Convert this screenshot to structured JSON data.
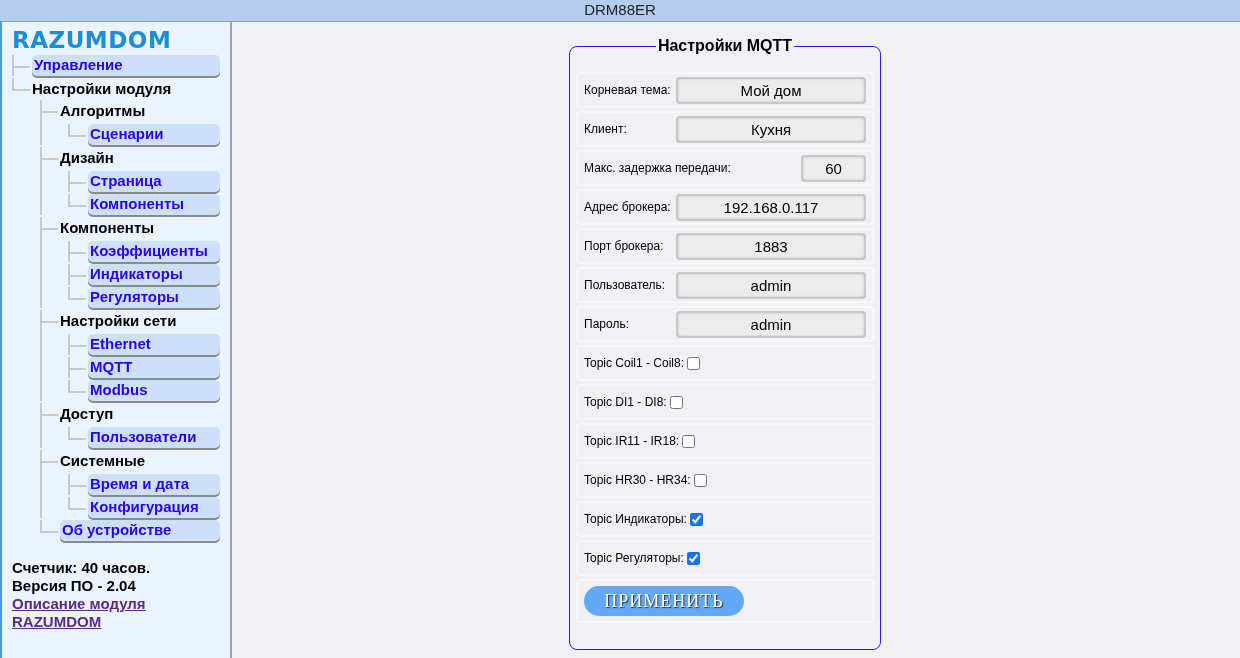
{
  "window": {
    "title": "DRM88ER"
  },
  "sidebar": {
    "logo": "RAZUMDOM",
    "tree": [
      {
        "kind": "link",
        "label": "Управление"
      },
      {
        "kind": "group",
        "label": "Настройки модуля",
        "children": [
          {
            "kind": "group",
            "label": "Алгоритмы",
            "children": [
              {
                "kind": "link",
                "label": "Сценарии"
              }
            ]
          },
          {
            "kind": "group",
            "label": "Дизайн",
            "children": [
              {
                "kind": "link",
                "label": "Страница"
              },
              {
                "kind": "link",
                "label": "Компоненты"
              }
            ]
          },
          {
            "kind": "group",
            "label": "Компоненты",
            "children": [
              {
                "kind": "link",
                "label": "Коэффициенты"
              },
              {
                "kind": "link",
                "label": "Индикаторы"
              },
              {
                "kind": "link",
                "label": "Регуляторы"
              }
            ]
          },
          {
            "kind": "group",
            "label": "Настройки сети",
            "children": [
              {
                "kind": "link",
                "label": "Ethernet"
              },
              {
                "kind": "link",
                "label": "MQTT"
              },
              {
                "kind": "link",
                "label": "Modbus"
              }
            ]
          },
          {
            "kind": "group",
            "label": "Доступ",
            "children": [
              {
                "kind": "link",
                "label": "Пользователи"
              }
            ]
          },
          {
            "kind": "group",
            "label": "Системные",
            "children": [
              {
                "kind": "link",
                "label": "Время и дата"
              },
              {
                "kind": "link",
                "label": "Конфигурация"
              }
            ]
          },
          {
            "kind": "link",
            "label": "Об устройстве"
          }
        ]
      }
    ],
    "info": [
      "Счетчик: 40 часов.",
      "Версия ПО - 2.04"
    ],
    "link_lines": [
      "Описание модуля",
      "RAZUMDOM"
    ]
  },
  "panel": {
    "title": "Настройки MQTT",
    "rows": [
      {
        "kind": "text",
        "label": "Корневая тема:",
        "value": "Мой дом"
      },
      {
        "kind": "text",
        "label": "Клиент:",
        "value": "Кухня"
      },
      {
        "kind": "short",
        "label": "Макс. задержка передачи:",
        "value": "60"
      },
      {
        "kind": "text",
        "label": "Адрес брокера:",
        "value": "192.168.0.117"
      },
      {
        "kind": "text",
        "label": "Порт брокера:",
        "value": "1883"
      },
      {
        "kind": "text",
        "label": "Пользователь:",
        "value": "admin"
      },
      {
        "kind": "text",
        "label": "Пароль:",
        "value": "admin"
      },
      {
        "kind": "checkbox",
        "label": "Topic Coil1 - Coil8:",
        "checked": false
      },
      {
        "kind": "checkbox",
        "label": "Topic DI1 - DI8:",
        "checked": false
      },
      {
        "kind": "checkbox",
        "label": "Topic IR11 - IR18:",
        "checked": false
      },
      {
        "kind": "checkbox",
        "label": "Topic HR30 - HR34:",
        "checked": false
      },
      {
        "kind": "checkbox",
        "label": "Topic Индикаторы:",
        "checked": true
      },
      {
        "kind": "checkbox",
        "label": "Topic Регуляторы:",
        "checked": true
      }
    ],
    "apply_button": "ПРИМЕНИТЬ"
  }
}
